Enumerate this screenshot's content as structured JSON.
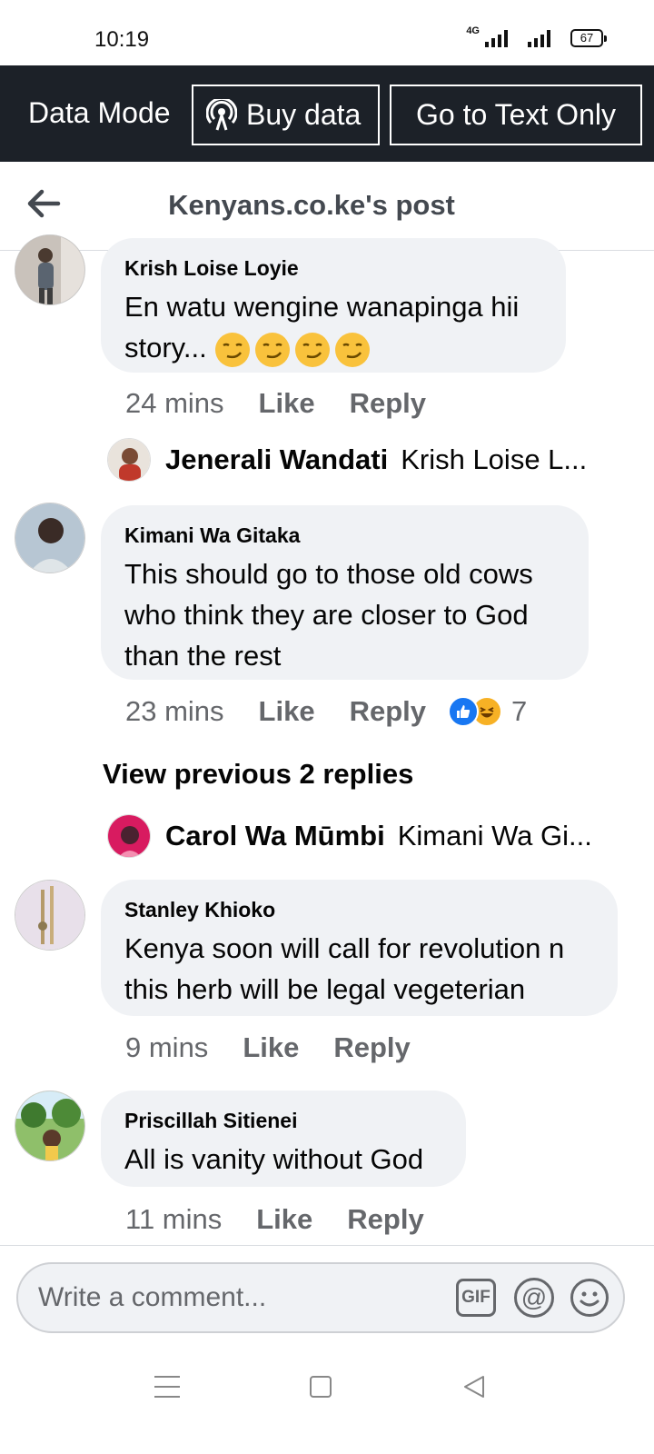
{
  "status": {
    "time": "10:19",
    "network": "4G",
    "battery": "67"
  },
  "data_bar": {
    "mode_label": "Data Mode",
    "buy_data": "Buy data",
    "text_only": "Go to Text Only"
  },
  "header": {
    "title": "Kenyans.co.ke's post"
  },
  "comments": [
    {
      "author": "Krish Loise Loyie",
      "text": "En watu wengine wanapinga hii story...",
      "emoji": "smirk-face x4",
      "time": "24 mins",
      "like": "Like",
      "reply": "Reply"
    },
    {
      "author": "Kimani Wa Gitaka",
      "text": "This should go to those old cows who think they are closer to God than the rest",
      "time": "23 mins",
      "like": "Like",
      "reply": "Reply",
      "reaction_count": "7"
    },
    {
      "author": "Stanley Khioko",
      "text": "Kenya soon will call for revolution n this herb will be legal vegeterian",
      "time": "9 mins",
      "like": "Like",
      "reply": "Reply"
    },
    {
      "author": "Priscillah Sitienei",
      "text": "All is vanity without God",
      "time": "11 mins",
      "like": "Like",
      "reply": "Reply"
    }
  ],
  "replies": [
    {
      "name": "Jenerali Wandati",
      "snippet": "Krish Loise L..."
    },
    {
      "name": "Carol Wa Mūmbi",
      "snippet": "Kimani Wa Gi..."
    }
  ],
  "view_previous": "View previous 2 replies",
  "composer": {
    "placeholder": "Write a comment...",
    "gif_label": "GIF",
    "at_label": "@"
  },
  "colors": {
    "data_bar_bg": "#1c2128",
    "bubble_bg": "#f0f2f5",
    "meta_text": "#65676b",
    "like_reaction": "#1877f2",
    "haha_reaction": "#f7b125"
  }
}
